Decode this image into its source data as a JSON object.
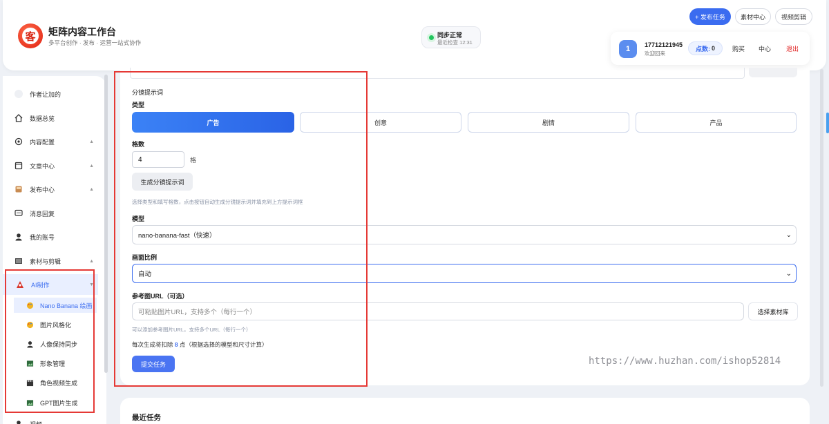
{
  "header": {
    "logo_char": "客",
    "title": "矩阵内容工作台",
    "subtitle": "多平台创作 · 发布 · 运营一站式协作",
    "sync_status": "同步正常",
    "sync_time": "最近检查 12:31",
    "publish_btn": "+ 发布任务",
    "material_btn": "素材中心",
    "video_btn": "视频剪辑"
  },
  "user": {
    "avatar": "1",
    "phone": "17712121945",
    "welcome": "欢迎回来",
    "points_label": "点数:",
    "points_value": "0",
    "buy": "购买",
    "center": "中心",
    "logout": "退出"
  },
  "sidebar": {
    "items": [
      {
        "label": "作者让加的",
        "icon": "blank-icon"
      },
      {
        "label": "数据总览",
        "icon": "home-icon"
      },
      {
        "label": "内容配置",
        "icon": "gear-icon",
        "arrow": "▲"
      },
      {
        "label": "文章中心",
        "icon": "document-icon",
        "arrow": "▲"
      },
      {
        "label": "发布中心",
        "icon": "box-icon",
        "arrow": "▲"
      },
      {
        "label": "消息回复",
        "icon": "chat-icon"
      },
      {
        "label": "我的账号",
        "icon": "person-icon"
      },
      {
        "label": "素材与剪辑",
        "icon": "film-icon",
        "arrow": "▲"
      },
      {
        "label": "AI制作",
        "icon": "ai-icon",
        "arrow": "▼"
      }
    ],
    "sub_items": [
      {
        "label": "Nano Banana 绘画",
        "icon": "palette-icon"
      },
      {
        "label": "图片风格化",
        "icon": "palette-icon"
      },
      {
        "label": "人像保持同步",
        "icon": "person-icon"
      },
      {
        "label": "形象管理",
        "icon": "image-icon"
      },
      {
        "label": "角色视频生成",
        "icon": "clapper-icon"
      },
      {
        "label": "GPT图片生成",
        "icon": "image-icon"
      }
    ],
    "bottom_label": "视频"
  },
  "form": {
    "section_title": "分镜提示词",
    "type_label": "类型",
    "types": [
      "广告",
      "创意",
      "剧情",
      "产品"
    ],
    "selected_type": "广告",
    "count_label": "格数",
    "count_value": "4",
    "count_unit": "格",
    "generate_btn": "生成分镜提示词",
    "generate_hint": "选择类型和填写格数，点击按钮自动生成分镜提示词并填充到上方提示词框",
    "model_label": "模型",
    "model_value": "nano-banana-fast（快速）",
    "ratio_label": "画面比例",
    "ratio_value": "自动",
    "ref_label": "参考图URL（可选）",
    "ref_placeholder": "可粘贴图片URL，支持多个（每行一个）",
    "pick_btn": "选择素材库",
    "ref_hint": "可以添加参考图片URL，支持多个URL（每行一个）",
    "cost_prefix": "每次生成将扣除",
    "cost_value": "8",
    "cost_suffix": "点（根据选择的模型和尺寸计算）",
    "submit_btn": "提交任务"
  },
  "watermark": "https://www.huzhan.com/ishop52814",
  "recent": {
    "title": "最近任务"
  },
  "colors": {
    "accent": "#3b6cf0",
    "annotation_red": "#e53935",
    "status_green": "#22c55e"
  }
}
